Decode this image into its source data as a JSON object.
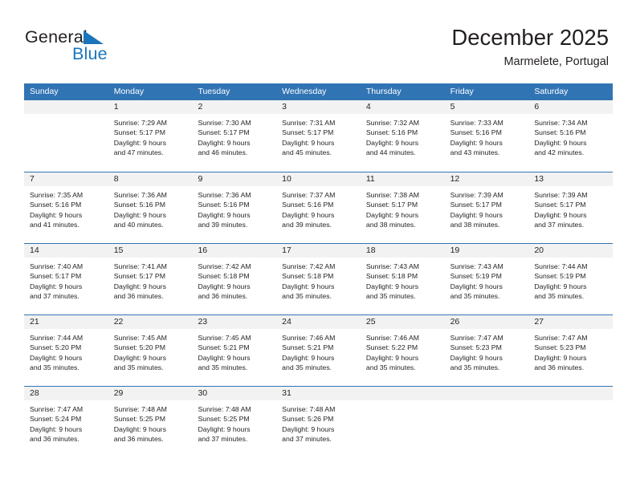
{
  "brand": {
    "name_top": "General",
    "name_bottom": "Blue",
    "accent_color": "#1b75bb"
  },
  "header": {
    "month_title": "December 2025",
    "location": "Marmelete, Portugal"
  },
  "theme": {
    "header_row_bg": "#3174b4",
    "day_number_bg": "#f2f2f2",
    "text_color": "#231f20"
  },
  "weekdays": [
    "Sunday",
    "Monday",
    "Tuesday",
    "Wednesday",
    "Thursday",
    "Friday",
    "Saturday"
  ],
  "weeks": [
    [
      {
        "day": "",
        "sunrise": "",
        "sunset": "",
        "daylight_line1": "",
        "daylight_line2": ""
      },
      {
        "day": "1",
        "sunrise": "Sunrise: 7:29 AM",
        "sunset": "Sunset: 5:17 PM",
        "daylight_line1": "Daylight: 9 hours",
        "daylight_line2": "and 47 minutes."
      },
      {
        "day": "2",
        "sunrise": "Sunrise: 7:30 AM",
        "sunset": "Sunset: 5:17 PM",
        "daylight_line1": "Daylight: 9 hours",
        "daylight_line2": "and 46 minutes."
      },
      {
        "day": "3",
        "sunrise": "Sunrise: 7:31 AM",
        "sunset": "Sunset: 5:17 PM",
        "daylight_line1": "Daylight: 9 hours",
        "daylight_line2": "and 45 minutes."
      },
      {
        "day": "4",
        "sunrise": "Sunrise: 7:32 AM",
        "sunset": "Sunset: 5:16 PM",
        "daylight_line1": "Daylight: 9 hours",
        "daylight_line2": "and 44 minutes."
      },
      {
        "day": "5",
        "sunrise": "Sunrise: 7:33 AM",
        "sunset": "Sunset: 5:16 PM",
        "daylight_line1": "Daylight: 9 hours",
        "daylight_line2": "and 43 minutes."
      },
      {
        "day": "6",
        "sunrise": "Sunrise: 7:34 AM",
        "sunset": "Sunset: 5:16 PM",
        "daylight_line1": "Daylight: 9 hours",
        "daylight_line2": "and 42 minutes."
      }
    ],
    [
      {
        "day": "7",
        "sunrise": "Sunrise: 7:35 AM",
        "sunset": "Sunset: 5:16 PM",
        "daylight_line1": "Daylight: 9 hours",
        "daylight_line2": "and 41 minutes."
      },
      {
        "day": "8",
        "sunrise": "Sunrise: 7:36 AM",
        "sunset": "Sunset: 5:16 PM",
        "daylight_line1": "Daylight: 9 hours",
        "daylight_line2": "and 40 minutes."
      },
      {
        "day": "9",
        "sunrise": "Sunrise: 7:36 AM",
        "sunset": "Sunset: 5:16 PM",
        "daylight_line1": "Daylight: 9 hours",
        "daylight_line2": "and 39 minutes."
      },
      {
        "day": "10",
        "sunrise": "Sunrise: 7:37 AM",
        "sunset": "Sunset: 5:16 PM",
        "daylight_line1": "Daylight: 9 hours",
        "daylight_line2": "and 39 minutes."
      },
      {
        "day": "11",
        "sunrise": "Sunrise: 7:38 AM",
        "sunset": "Sunset: 5:17 PM",
        "daylight_line1": "Daylight: 9 hours",
        "daylight_line2": "and 38 minutes."
      },
      {
        "day": "12",
        "sunrise": "Sunrise: 7:39 AM",
        "sunset": "Sunset: 5:17 PM",
        "daylight_line1": "Daylight: 9 hours",
        "daylight_line2": "and 38 minutes."
      },
      {
        "day": "13",
        "sunrise": "Sunrise: 7:39 AM",
        "sunset": "Sunset: 5:17 PM",
        "daylight_line1": "Daylight: 9 hours",
        "daylight_line2": "and 37 minutes."
      }
    ],
    [
      {
        "day": "14",
        "sunrise": "Sunrise: 7:40 AM",
        "sunset": "Sunset: 5:17 PM",
        "daylight_line1": "Daylight: 9 hours",
        "daylight_line2": "and 37 minutes."
      },
      {
        "day": "15",
        "sunrise": "Sunrise: 7:41 AM",
        "sunset": "Sunset: 5:17 PM",
        "daylight_line1": "Daylight: 9 hours",
        "daylight_line2": "and 36 minutes."
      },
      {
        "day": "16",
        "sunrise": "Sunrise: 7:42 AM",
        "sunset": "Sunset: 5:18 PM",
        "daylight_line1": "Daylight: 9 hours",
        "daylight_line2": "and 36 minutes."
      },
      {
        "day": "17",
        "sunrise": "Sunrise: 7:42 AM",
        "sunset": "Sunset: 5:18 PM",
        "daylight_line1": "Daylight: 9 hours",
        "daylight_line2": "and 35 minutes."
      },
      {
        "day": "18",
        "sunrise": "Sunrise: 7:43 AM",
        "sunset": "Sunset: 5:18 PM",
        "daylight_line1": "Daylight: 9 hours",
        "daylight_line2": "and 35 minutes."
      },
      {
        "day": "19",
        "sunrise": "Sunrise: 7:43 AM",
        "sunset": "Sunset: 5:19 PM",
        "daylight_line1": "Daylight: 9 hours",
        "daylight_line2": "and 35 minutes."
      },
      {
        "day": "20",
        "sunrise": "Sunrise: 7:44 AM",
        "sunset": "Sunset: 5:19 PM",
        "daylight_line1": "Daylight: 9 hours",
        "daylight_line2": "and 35 minutes."
      }
    ],
    [
      {
        "day": "21",
        "sunrise": "Sunrise: 7:44 AM",
        "sunset": "Sunset: 5:20 PM",
        "daylight_line1": "Daylight: 9 hours",
        "daylight_line2": "and 35 minutes."
      },
      {
        "day": "22",
        "sunrise": "Sunrise: 7:45 AM",
        "sunset": "Sunset: 5:20 PM",
        "daylight_line1": "Daylight: 9 hours",
        "daylight_line2": "and 35 minutes."
      },
      {
        "day": "23",
        "sunrise": "Sunrise: 7:45 AM",
        "sunset": "Sunset: 5:21 PM",
        "daylight_line1": "Daylight: 9 hours",
        "daylight_line2": "and 35 minutes."
      },
      {
        "day": "24",
        "sunrise": "Sunrise: 7:46 AM",
        "sunset": "Sunset: 5:21 PM",
        "daylight_line1": "Daylight: 9 hours",
        "daylight_line2": "and 35 minutes."
      },
      {
        "day": "25",
        "sunrise": "Sunrise: 7:46 AM",
        "sunset": "Sunset: 5:22 PM",
        "daylight_line1": "Daylight: 9 hours",
        "daylight_line2": "and 35 minutes."
      },
      {
        "day": "26",
        "sunrise": "Sunrise: 7:47 AM",
        "sunset": "Sunset: 5:23 PM",
        "daylight_line1": "Daylight: 9 hours",
        "daylight_line2": "and 35 minutes."
      },
      {
        "day": "27",
        "sunrise": "Sunrise: 7:47 AM",
        "sunset": "Sunset: 5:23 PM",
        "daylight_line1": "Daylight: 9 hours",
        "daylight_line2": "and 36 minutes."
      }
    ],
    [
      {
        "day": "28",
        "sunrise": "Sunrise: 7:47 AM",
        "sunset": "Sunset: 5:24 PM",
        "daylight_line1": "Daylight: 9 hours",
        "daylight_line2": "and 36 minutes."
      },
      {
        "day": "29",
        "sunrise": "Sunrise: 7:48 AM",
        "sunset": "Sunset: 5:25 PM",
        "daylight_line1": "Daylight: 9 hours",
        "daylight_line2": "and 36 minutes."
      },
      {
        "day": "30",
        "sunrise": "Sunrise: 7:48 AM",
        "sunset": "Sunset: 5:25 PM",
        "daylight_line1": "Daylight: 9 hours",
        "daylight_line2": "and 37 minutes."
      },
      {
        "day": "31",
        "sunrise": "Sunrise: 7:48 AM",
        "sunset": "Sunset: 5:26 PM",
        "daylight_line1": "Daylight: 9 hours",
        "daylight_line2": "and 37 minutes."
      },
      {
        "day": "",
        "sunrise": "",
        "sunset": "",
        "daylight_line1": "",
        "daylight_line2": ""
      },
      {
        "day": "",
        "sunrise": "",
        "sunset": "",
        "daylight_line1": "",
        "daylight_line2": ""
      },
      {
        "day": "",
        "sunrise": "",
        "sunset": "",
        "daylight_line1": "",
        "daylight_line2": ""
      }
    ]
  ]
}
